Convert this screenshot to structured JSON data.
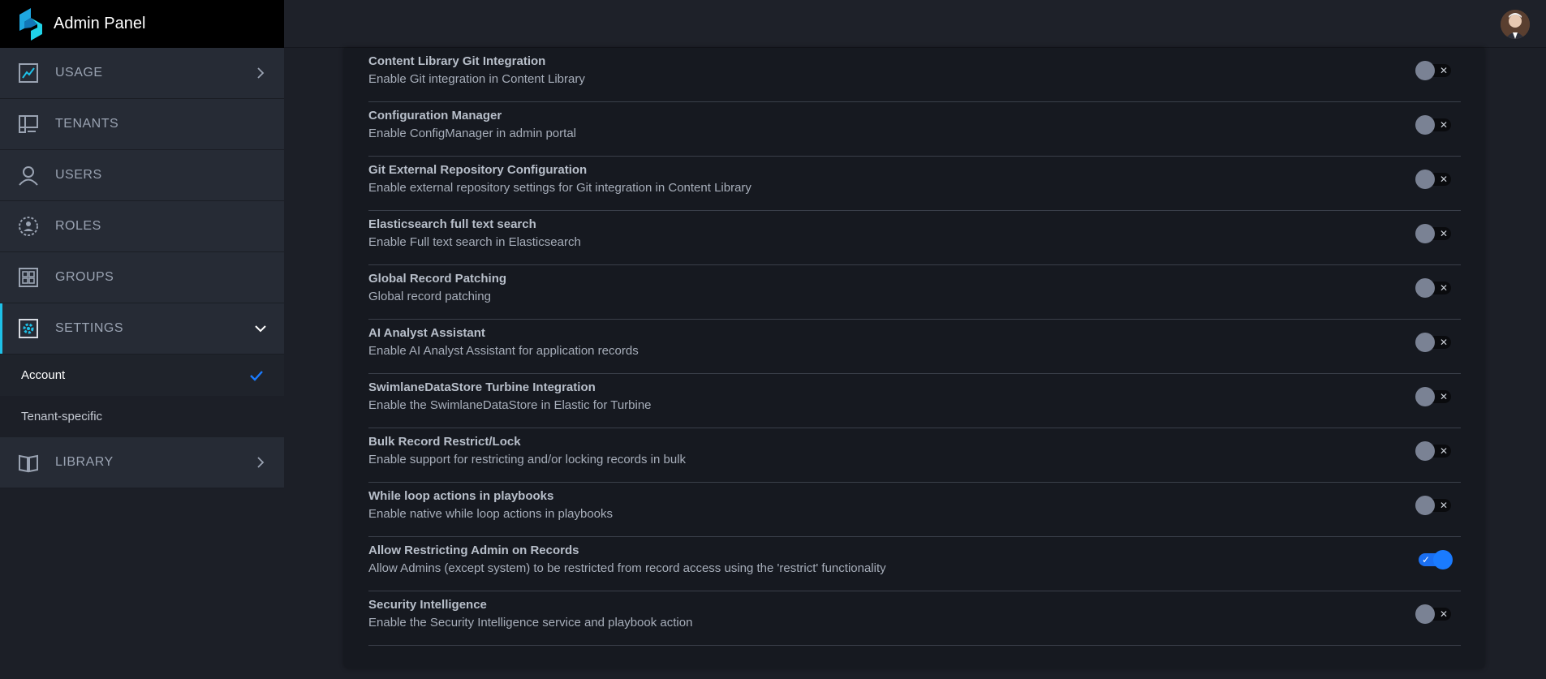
{
  "brand": {
    "title": "Admin Panel"
  },
  "nav": {
    "items": [
      {
        "label": "USAGE",
        "icon": "chart-icon"
      },
      {
        "label": "TENANTS",
        "icon": "tenants-icon"
      },
      {
        "label": "USERS",
        "icon": "user-icon"
      },
      {
        "label": "ROLES",
        "icon": "roles-icon"
      },
      {
        "label": "GROUPS",
        "icon": "groups-icon"
      },
      {
        "label": "SETTINGS",
        "icon": "settings-icon"
      },
      {
        "label": "LIBRARY",
        "icon": "library-icon"
      }
    ],
    "settings_sub": [
      {
        "label": "Account",
        "selected": true
      },
      {
        "label": "Tenant-specific",
        "selected": false
      }
    ]
  },
  "colors": {
    "accent": "#1ec1e8",
    "toggle_on": "#1a7bff",
    "toggle_off": "#7a8294"
  },
  "settings": [
    {
      "title": "Content Library Git Integration",
      "desc": "Enable Git integration in Content Library",
      "enabled": false
    },
    {
      "title": "Configuration Manager",
      "desc": "Enable ConfigManager in admin portal",
      "enabled": false
    },
    {
      "title": "Git External Repository Configuration",
      "desc": "Enable external repository settings for Git integration in Content Library",
      "enabled": false
    },
    {
      "title": "Elasticsearch full text search",
      "desc": "Enable Full text search in Elasticsearch",
      "enabled": false
    },
    {
      "title": "Global Record Patching",
      "desc": "Global record patching",
      "enabled": false
    },
    {
      "title": "AI Analyst Assistant",
      "desc": "Enable AI Analyst Assistant for application records",
      "enabled": false
    },
    {
      "title": "SwimlaneDataStore Turbine Integration",
      "desc": "Enable the SwimlaneDataStore in Elastic for Turbine",
      "enabled": false
    },
    {
      "title": "Bulk Record Restrict/Lock",
      "desc": "Enable support for restricting and/or locking records in bulk",
      "enabled": false
    },
    {
      "title": "While loop actions in playbooks",
      "desc": "Enable native while loop actions in playbooks",
      "enabled": false
    },
    {
      "title": "Allow Restricting Admin on Records",
      "desc": "Allow Admins (except system) to be restricted from record access using the 'restrict' functionality",
      "enabled": true
    },
    {
      "title": "Security Intelligence",
      "desc": "Enable the Security Intelligence service and playbook action",
      "enabled": false
    }
  ]
}
